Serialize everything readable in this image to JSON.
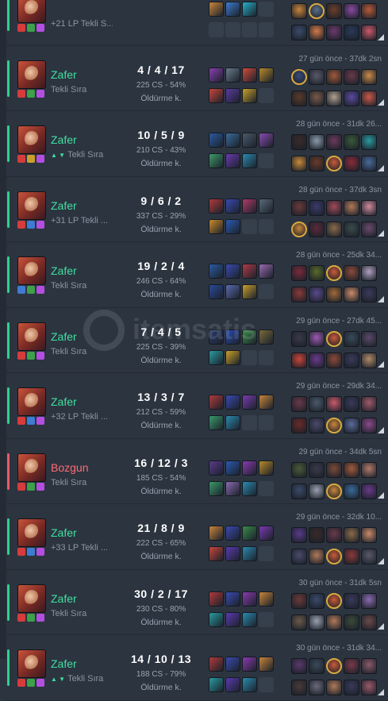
{
  "colors": {
    "win": "#2fd18a",
    "loss": "#e85a63",
    "background": "#2c3440",
    "highlight_ring": "#d9a93e"
  },
  "labels": {
    "kill_label": "Öldürme k."
  },
  "watermark": "itemsatis",
  "matches": [
    {
      "result": "win",
      "result_label": "",
      "queue": "+21 LP Tekli S...",
      "queue_arrow": "",
      "kda": "",
      "cs": "",
      "time": "",
      "champion_icon": "champion-portrait",
      "spells": [
        "#d63c3c",
        "#3ea04a",
        "#b44ee0"
      ],
      "items": [
        "#c9853a",
        "#3e7bd1",
        "#26b0c9"
      ],
      "players": [
        "#c9853a",
        "#5a6e8a",
        "#6b3e2a",
        "#8a4aa0",
        "#b85a3a",
        "#3a4a6a",
        "#d27a4a",
        "#6a3a6a",
        "#2a3a5a",
        "#c95a6a"
      ],
      "me_index": 1,
      "partial": true
    },
    {
      "result": "win",
      "result_label": "Zafer",
      "queue": "Tekli Sıra",
      "queue_arrow": "",
      "kda": "4 / 4 / 17",
      "cs": "225 CS - 54%",
      "time": "27 gün önce - 37dk 2sn",
      "champion_icon": "champion-portrait",
      "spells": [
        "#d63c3c",
        "#3ea04a",
        "#b44ee0"
      ],
      "items": [
        "#8a3fb0",
        "#6a7a8a",
        "#d24a3a",
        "#b88a2a",
        "#c9453a",
        "#5a3aa0",
        "#c9a02a"
      ],
      "players": [
        "#3a4a7a",
        "#5a5a6a",
        "#a05a3a",
        "#6a3a4a",
        "#c98a4a",
        "#5a3a2a",
        "#7a5a4a",
        "#b0a090",
        "#5a4aa0",
        "#c95a4a"
      ],
      "me_index": 0
    },
    {
      "result": "win",
      "result_label": "Zafer",
      "queue": "Tekli Sıra",
      "queue_arrow": "▲ ▼",
      "kda": "10 / 5 / 9",
      "cs": "210 CS - 43%",
      "time": "28 gün önce - 31dk 26...",
      "champion_icon": "champion-portrait",
      "spells": [
        "#d63c3c",
        "#c9a02a",
        "#b44ee0"
      ],
      "items": [
        "#2a5aa0",
        "#3a6a9a",
        "#4a5a6a",
        "#8a4ab0",
        "#3e9a6a",
        "#6a3ab0",
        "#2a8ab0"
      ],
      "players": [
        "#3a2a2a",
        "#8a9aaa",
        "#6a3a5a",
        "#3a5a3a",
        "#2a9aa0",
        "#c98a3a",
        "#6a3a2a",
        "#c95a3a",
        "#8a2a3a",
        "#4a6a9a"
      ],
      "me_index": 7
    },
    {
      "result": "win",
      "result_label": "Zafer",
      "queue": "+31 LP Tekli ...",
      "queue_arrow": "",
      "kda": "9 / 6 / 2",
      "cs": "337 CS - 29%",
      "time": "28 gün önce - 37dk 3sn",
      "champion_icon": "champion-portrait",
      "spells": [
        "#d63c3c",
        "#3e7bd1",
        "#b44ee0"
      ],
      "items": [
        "#b03a3a",
        "#3a4ab0",
        "#b03a6a",
        "#5a6a7a",
        "#c98a2a",
        "#2a5ab0"
      ],
      "players": [
        "#6a3a3a",
        "#3a3a6a",
        "#a04a5a",
        "#b07a5a",
        "#d08a9a",
        "#c9853a",
        "#5a2a3a",
        "#8a6a4a",
        "#3a4a4a",
        "#6a4a6a"
      ],
      "me_index": 5
    },
    {
      "result": "win",
      "result_label": "Zafer",
      "queue": "Tekli Sıra",
      "queue_arrow": "",
      "kda": "19 / 2 / 4",
      "cs": "246 CS - 64%",
      "time": "28 gün önce - 25dk 34...",
      "champion_icon": "champion-portrait",
      "spells": [
        "#3e7bd1",
        "#3ea04a",
        "#b44ee0"
      ],
      "items": [
        "#2a5aa0",
        "#3a4ab0",
        "#b03a4a",
        "#9a6ab0",
        "#2a4a9a",
        "#5a6ab0",
        "#c9a02a"
      ],
      "players": [
        "#7a2a3a",
        "#5a6a2a",
        "#c95a3a",
        "#8a4a3a",
        "#b0a0c0",
        "#8a3a3a",
        "#5a4a8a",
        "#a06a3a",
        "#c98a6a",
        "#3a3a5a"
      ],
      "me_index": 2
    },
    {
      "result": "win",
      "result_label": "Zafer",
      "queue": "Tekli Sıra",
      "queue_arrow": "",
      "kda": "7 / 4 / 5",
      "cs": "225 CS - 39%",
      "time": "29 gün önce - 27dk 45...",
      "champion_icon": "champion-portrait",
      "spells": [
        "#d63c3c",
        "#3ea04a",
        "#b44ee0"
      ],
      "items": [
        "#2a3a6a",
        "#2a4ab0",
        "#3a8a4a",
        "#7a6a3a",
        "#2a9aa0",
        "#c9a02a"
      ],
      "players": [
        "#3a3a4a",
        "#9a5ab0",
        "#c95a3a",
        "#3a4a5a",
        "#5a4a6a",
        "#c9453a",
        "#6a3a8a",
        "#8a4a3a",
        "#3a3a5a",
        "#b08a6a"
      ],
      "me_index": 2
    },
    {
      "result": "win",
      "result_label": "Zafer",
      "queue": "+32 LP Tekli ...",
      "queue_arrow": "",
      "kda": "13 / 3 / 7",
      "cs": "212 CS - 59%",
      "time": "29 gün önce - 29dk 34...",
      "champion_icon": "champion-portrait",
      "spells": [
        "#d63c3c",
        "#3e7bd1",
        "#b44ee0"
      ],
      "items": [
        "#b03a3a",
        "#3a4ab0",
        "#7a3ab0",
        "#c9853a",
        "#3a9a6a",
        "#2a8ab0"
      ],
      "players": [
        "#6a3a4a",
        "#4a5a6a",
        "#c95a6a",
        "#3a3a5a",
        "#a05a6a",
        "#6a2a2a",
        "#4a4a6a",
        "#c9853a",
        "#5a6a9a",
        "#8a4a8a"
      ],
      "me_index": 7
    },
    {
      "result": "loss",
      "result_label": "Bozgun",
      "queue": "Tekli Sıra",
      "queue_arrow": "",
      "kda": "16 / 12 / 3",
      "cs": "185 CS - 54%",
      "time": "29 gün önce - 34dk 5sn",
      "champion_icon": "champion-portrait",
      "spells": [
        "#d63c3c",
        "#3ea04a",
        "#b44ee0"
      ],
      "items": [
        "#5a3a8a",
        "#2a5ab0",
        "#8a3ab0",
        "#b88a2a",
        "#3a9a6a",
        "#8a6ab0",
        "#2a8ab0"
      ],
      "players": [
        "#4a5a3a",
        "#3a3a4a",
        "#7a4a3a",
        "#a05a3a",
        "#b07a6a",
        "#3a4a6a",
        "#9aa0b0",
        "#c9853a",
        "#3a6a9a",
        "#6a3a8a"
      ],
      "me_index": 7
    },
    {
      "result": "win",
      "result_label": "Zafer",
      "queue": "+33 LP Tekli ...",
      "queue_arrow": "",
      "kda": "21 / 8 / 9",
      "cs": "222 CS - 65%",
      "time": "29 gün önce - 32dk 10...",
      "champion_icon": "champion-portrait",
      "spells": [
        "#d63c3c",
        "#3e7bd1",
        "#b44ee0"
      ],
      "items": [
        "#c9853a",
        "#3a4ab0",
        "#3a8a4a",
        "#7a3ab0",
        "#c9453a",
        "#5a3ab0",
        "#2a8ab0"
      ],
      "players": [
        "#5a3a8a",
        "#3a2a2a",
        "#6a3a4a",
        "#8a6a4a",
        "#c98a6a",
        "#4a4a6a",
        "#b07a5a",
        "#c95a3a",
        "#8a3a3a",
        "#5a5a6a"
      ],
      "me_index": 7
    },
    {
      "result": "win",
      "result_label": "Zafer",
      "queue": "Tekli Sıra",
      "queue_arrow": "",
      "kda": "30 / 2 / 17",
      "cs": "230 CS - 80%",
      "time": "30 gün önce - 31dk 5sn",
      "champion_icon": "champion-portrait",
      "spells": [
        "#d63c3c",
        "#3ea04a",
        "#b44ee0"
      ],
      "items": [
        "#b03a3a",
        "#3a4ab0",
        "#8a3ab0",
        "#c9853a",
        "#2a9aa0",
        "#5a3ab0",
        "#2a8ab0"
      ],
      "players": [
        "#6a3a3a",
        "#3a4a6a",
        "#c95a3a",
        "#3a3a5a",
        "#8a6ab0",
        "#6a5a4a",
        "#9aa0b0",
        "#b07a5a",
        "#3a4a3a",
        "#6a4a4a"
      ],
      "me_index": 2
    },
    {
      "result": "win",
      "result_label": "Zafer",
      "queue": "Tekli Sıra",
      "queue_arrow": "▲ ▼",
      "kda": "14 / 10 / 13",
      "cs": "188 CS - 79%",
      "time": "30 gün önce - 31dk 34...",
      "champion_icon": "champion-portrait",
      "spells": [
        "#d63c3c",
        "#3ea04a",
        "#b44ee0"
      ],
      "items": [
        "#b03a3a",
        "#3a4ab0",
        "#8a3ab0",
        "#c9853a",
        "#2a9aa0",
        "#5a3ab0",
        "#2a8ab0"
      ],
      "players": [
        "#5a3a6a",
        "#3a4a5a",
        "#c95a3a",
        "#7a3a4a",
        "#8a5a6a",
        "#4a3a3a",
        "#6a6a7a",
        "#b07a5a",
        "#3a3a5a",
        "#9a5a6a"
      ],
      "me_index": 2
    }
  ]
}
